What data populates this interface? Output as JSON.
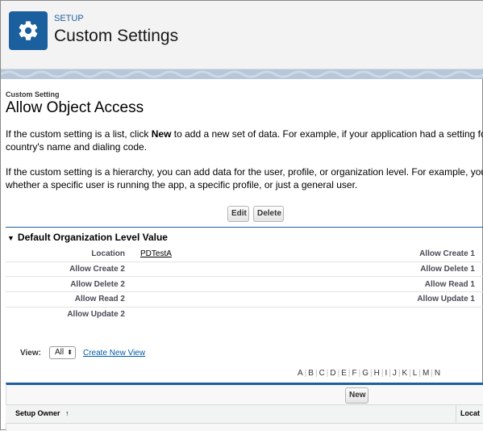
{
  "header": {
    "eyebrow": "SETUP",
    "title": "Custom Settings",
    "icon": "gear-icon"
  },
  "page": {
    "eyebrow": "Custom Setting",
    "title": "Allow Object Access",
    "para1_a": "If the custom setting is a list, click ",
    "para1_b": "New",
    "para1_c": " to add a new set of data. For example, if your application had a setting fo",
    "para1_line2": "country's name and dialing code.",
    "para2_line1": "If the custom setting is a hierarchy, you can add data for the user, profile, or organization level. For example, you",
    "para2_line2": "whether a specific user is running the app, a specific profile, or just a general user."
  },
  "buttons": {
    "edit": "Edit",
    "delete": "Delete",
    "new": "New"
  },
  "section": {
    "title": "Default Organization Level Value",
    "rows": [
      {
        "left_label": "Location",
        "left_value": "PDTestA",
        "right_label": "Allow Create 1"
      },
      {
        "left_label": "Allow Create 2",
        "right_label": "Allow Delete 1"
      },
      {
        "left_label": "Allow Delete 2",
        "right_label": "Allow Read 1"
      },
      {
        "left_label": "Allow Read 2",
        "right_label": "Allow Update 1"
      },
      {
        "left_label": "Allow Update 2"
      }
    ]
  },
  "view": {
    "label": "View:",
    "selected": "All",
    "create_link": "Create New View"
  },
  "alphabet": [
    "A",
    "B",
    "C",
    "D",
    "E",
    "F",
    "G",
    "H",
    "I",
    "J",
    "K",
    "L",
    "M",
    "N"
  ],
  "table": {
    "col_owner": "Setup Owner",
    "sort_arrow": "↑",
    "col_location": "Locat"
  },
  "colors": {
    "brand": "#1b5f9e",
    "link": "#015ba7"
  }
}
